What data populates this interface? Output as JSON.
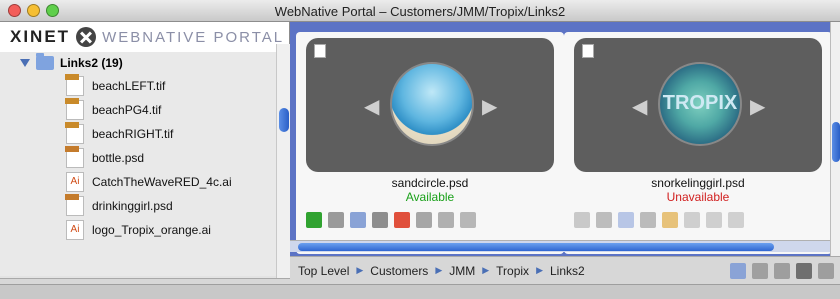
{
  "window": {
    "title": "WebNative Portal – Customers/JMM/Tropix/Links2"
  },
  "brand": {
    "left": "XINET",
    "right": "WEBNATIVE PORTAL"
  },
  "tree": {
    "root_label": "Links2 (19)",
    "files": [
      {
        "name": "beachLEFT.tif",
        "type": "TIFF"
      },
      {
        "name": "beachPG4.tif",
        "type": "TIFF"
      },
      {
        "name": "beachRIGHT.tif",
        "type": "TIFF"
      },
      {
        "name": "bottle.psd",
        "type": "PHOTO"
      },
      {
        "name": "CatchTheWaveRED_4c.ai",
        "type": "AI"
      },
      {
        "name": "drinkinggirl.psd",
        "type": "PHOTO"
      },
      {
        "name": "logo_Tropix_orange.ai",
        "type": "AI"
      }
    ]
  },
  "cards": [
    {
      "filename": "sandcircle.psd",
      "status": "Available",
      "status_color": "#1aa11a"
    },
    {
      "filename": "snorkelinggirl.psd",
      "status": "Unavailable",
      "status_color": "#d11f1f",
      "thumb_text": "TROPIX"
    }
  ],
  "breadcrumb": {
    "items": [
      "Top Level",
      "Customers",
      "JMM",
      "Tropix",
      "Links2"
    ]
  },
  "colors": {
    "panel_bg": "#5c73c5",
    "available": "#1aa11a",
    "unavailable": "#d11f1f"
  }
}
